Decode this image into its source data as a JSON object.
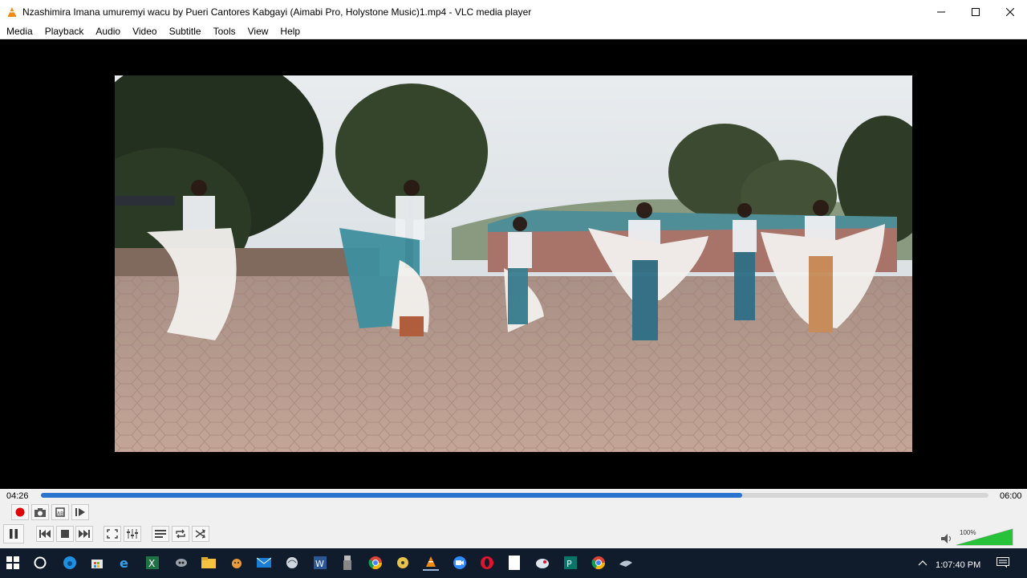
{
  "window": {
    "title": "Nzashimira Imana umuremyi wacu by Pueri Cantores  Kabgayi (Aimabi Pro,  Holystone Music)1.mp4 - VLC media player",
    "buttons": [
      "minimize-icon",
      "maximize-icon",
      "close-icon"
    ]
  },
  "menu": {
    "items": [
      "Media",
      "Playback",
      "Audio",
      "Video",
      "Subtitle",
      "Tools",
      "View",
      "Help"
    ]
  },
  "video": {
    "frame_content": "video-frame"
  },
  "playback": {
    "elapsed": "04:26",
    "total": "06:00",
    "progress": 0.74
  },
  "controls": {
    "top_row": [
      "record-icon",
      "snapshot-icon",
      "loop-ab-icon",
      "frame-by-frame-icon"
    ],
    "bottom_row": [
      "pause-icon",
      "previous-icon",
      "stop-icon",
      "next-icon",
      "fullscreen-icon",
      "extended-settings-icon",
      "playlist-icon",
      "loop-icon",
      "shuffle-icon"
    ]
  },
  "volume": {
    "label": "100%",
    "level": 1.0,
    "icon": "speaker-icon"
  },
  "taskbar": {
    "icons": [
      "windows-start-icon",
      "cortana-icon",
      "edge-icon",
      "store-icon",
      "ie-icon",
      "excel-icon",
      "app-icon",
      "file-explorer-icon",
      "app-icon",
      "mail-icon",
      "app-icon",
      "word-icon",
      "usb-icon",
      "chrome-icon",
      "app-icon",
      "vlc-icon",
      "zoom-icon",
      "opera-icon",
      "document-icon",
      "app-icon",
      "publisher-icon",
      "chrome-icon",
      "app-icon"
    ],
    "clock": "1:07:40 PM",
    "tray": [
      "chevron-up-icon",
      "notification-icon"
    ]
  },
  "colors": {
    "seek_fill": "#2a74d0",
    "volume_fill": "#27c13a",
    "record": "#e00000",
    "taskbar": "#101b2c"
  }
}
